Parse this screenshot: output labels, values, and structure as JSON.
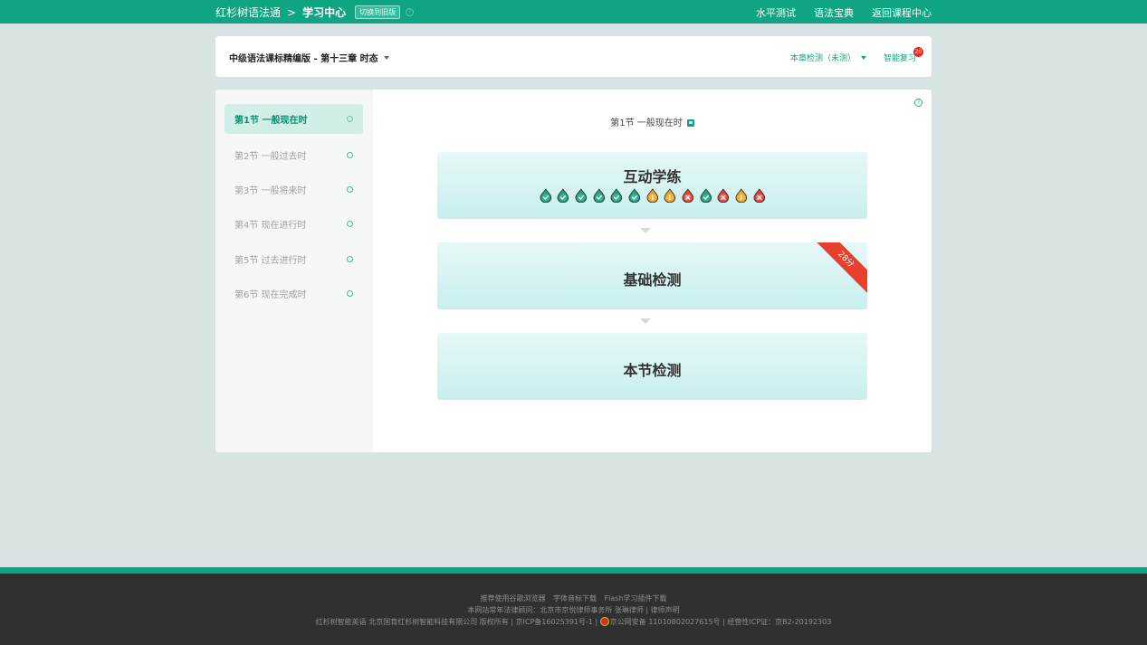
{
  "topbar": {
    "brand": "红杉树语法通",
    "separator": ">",
    "current": "学习中心",
    "switch_label": "切换到旧版",
    "nav": [
      "水平测试",
      "语法宝典",
      "返回课程中心"
    ]
  },
  "header": {
    "course_title": "中级语法课标精编版 - 第十三章 时态",
    "chapter_test": "本章检测（未测）",
    "smart_review": "智能复习",
    "review_badge": "20"
  },
  "sidebar": {
    "items": [
      {
        "label": "第1节 一般现在时",
        "active": true
      },
      {
        "label": "第2节 一般过去时",
        "active": false
      },
      {
        "label": "第3节 一般将来时",
        "active": false
      },
      {
        "label": "第4节 现在进行时",
        "active": false
      },
      {
        "label": "第5节 过去进行时",
        "active": false
      },
      {
        "label": "第6节 现在完成时",
        "active": false
      }
    ]
  },
  "content": {
    "section_title": "第1节 一般现在时",
    "blocks": [
      {
        "label": "互动学练"
      },
      {
        "label": "基础检测",
        "ribbon": "28分"
      },
      {
        "label": "本节检测"
      }
    ],
    "progress": [
      "correct",
      "correct",
      "correct",
      "correct",
      "correct",
      "correct",
      "warning",
      "warning",
      "wrong",
      "correct",
      "wrong",
      "warning",
      "wrong"
    ]
  },
  "colors": {
    "brand": "#0fa583",
    "correct": "#1aa37f",
    "warning": "#f0a21c",
    "wrong": "#e5402e"
  },
  "footer": {
    "links": [
      "推荐使用谷歌浏览器",
      "字体音标下载",
      "Flash学习插件下载"
    ],
    "legal": "本网站常年法律顾问：北京市京悦律师事务所 张琳律师 | 律师声明",
    "copyright": "红杉树智能英语 北京国育红杉树智能科技有限公司 版权所有 | 京ICP备16025391号-1 |",
    "police": "京公网安备 11010802027615号 | 经营性ICP证：京B2-20192303"
  }
}
